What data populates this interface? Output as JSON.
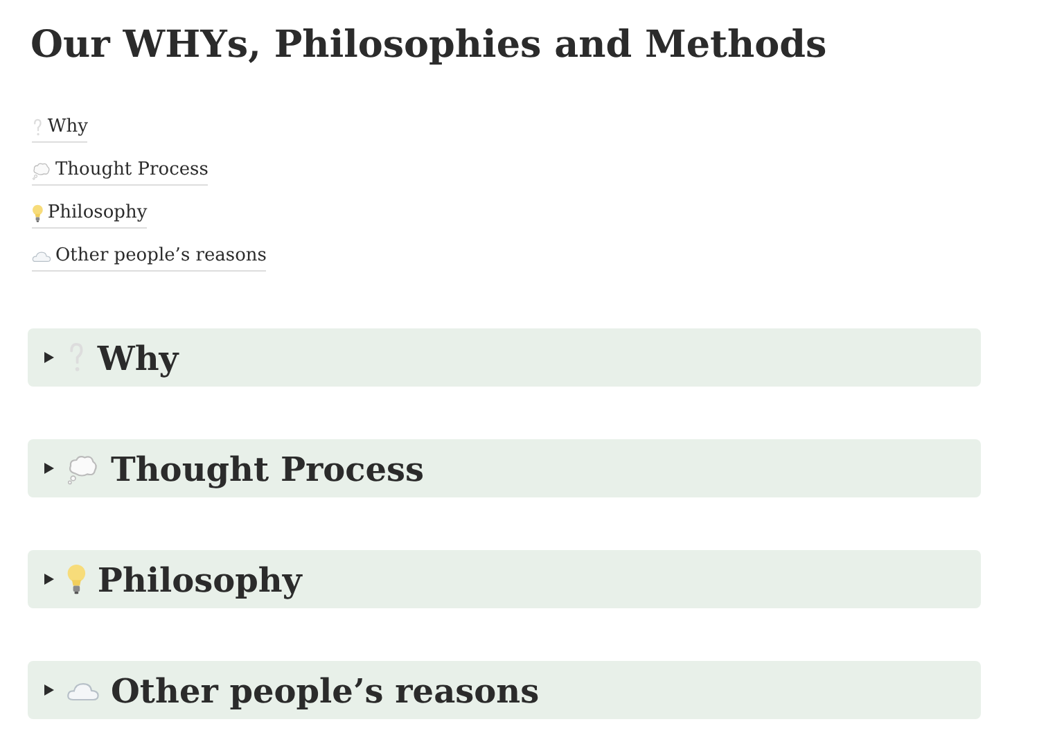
{
  "title": "Our WHYs, Philosophies and Methods",
  "links": [
    {
      "label": "Why",
      "kind": "question"
    },
    {
      "label": "Thought Process",
      "kind": "thought"
    },
    {
      "label": "Philosophy",
      "kind": "bulb"
    },
    {
      "label": "Other people’s reasons",
      "kind": "cloud"
    }
  ],
  "toggles": [
    {
      "label": "Why",
      "kind": "question",
      "expanded": false
    },
    {
      "label": "Thought Process",
      "kind": "thought",
      "expanded": false
    },
    {
      "label": "Philosophy",
      "kind": "bulb",
      "expanded": false
    },
    {
      "label": "Other people’s reasons",
      "kind": "cloud",
      "expanded": false
    }
  ]
}
